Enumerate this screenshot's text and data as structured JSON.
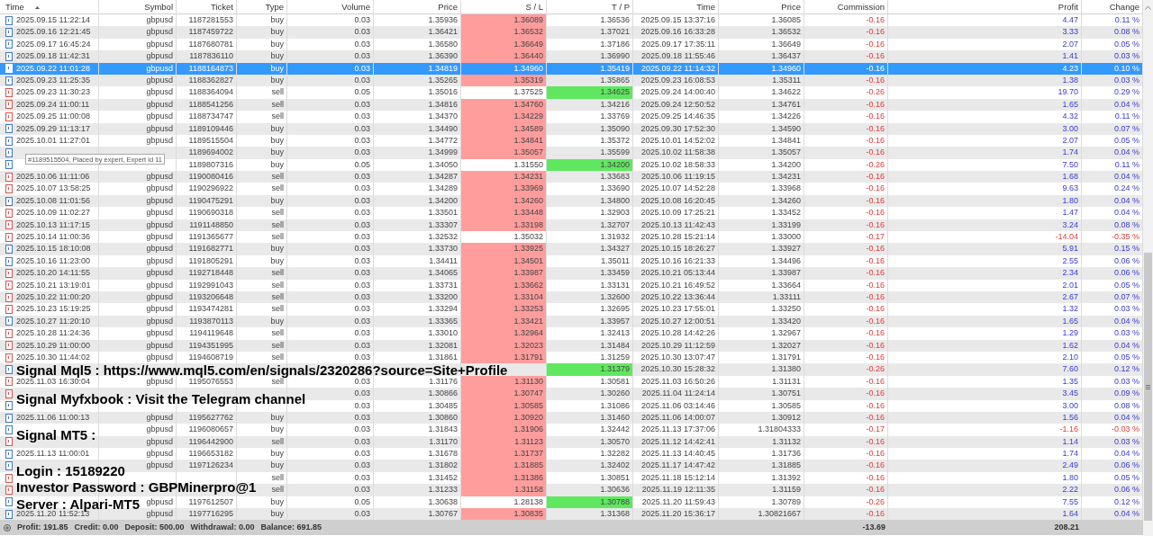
{
  "columns": [
    {
      "label": "Time",
      "sorted": true
    },
    {
      "label": "Symbol",
      "sorted": false
    },
    {
      "label": "Ticket",
      "sorted": false
    },
    {
      "label": "Type",
      "sorted": false
    },
    {
      "label": "Volume",
      "sorted": false
    },
    {
      "label": "Price",
      "sorted": false
    },
    {
      "label": "S / L",
      "sorted": false
    },
    {
      "label": "T / P",
      "sorted": false
    },
    {
      "label": "Time",
      "sorted": false
    },
    {
      "label": "Price",
      "sorted": false
    },
    {
      "label": "Commission",
      "sorted": false
    },
    {
      "label": "Profit",
      "sorted": false
    },
    {
      "label": "Change",
      "sorted": false
    }
  ],
  "rows": [
    {
      "kind": "buy",
      "selected": false,
      "sl_hit": true,
      "tp_hit": false,
      "loss": false,
      "time": "2025.09.15 11:22:14",
      "symbol": "gbpusd",
      "ticket": "1187281553",
      "type": "buy",
      "volume": "0.03",
      "price": "1.35936",
      "sl": "1.36089",
      "tp": "1.36536",
      "close_time": "2025.09.15 13:37:16",
      "close_price": "1.36085",
      "commission": "-0.16",
      "profit": "4.47",
      "change": "0.11 %"
    },
    {
      "kind": "buy",
      "selected": false,
      "sl_hit": true,
      "tp_hit": false,
      "loss": false,
      "time": "2025.09.16 12:21:45",
      "symbol": "gbpusd",
      "ticket": "1187459722",
      "type": "buy",
      "volume": "0.03",
      "price": "1.36421",
      "sl": "1.36532",
      "tp": "1.37021",
      "close_time": "2025.09.16 16:33:28",
      "close_price": "1.36532",
      "commission": "-0.16",
      "profit": "3.33",
      "change": "0.08 %"
    },
    {
      "kind": "buy",
      "selected": false,
      "sl_hit": true,
      "tp_hit": false,
      "loss": false,
      "time": "2025.09.17 16:45:24",
      "symbol": "gbpusd",
      "ticket": "1187680781",
      "type": "buy",
      "volume": "0.03",
      "price": "1.36580",
      "sl": "1.36649",
      "tp": "1.37186",
      "close_time": "2025.09.17 17:35:11",
      "close_price": "1.36649",
      "commission": "-0.16",
      "profit": "2.07",
      "change": "0.05 %"
    },
    {
      "kind": "buy",
      "selected": false,
      "sl_hit": true,
      "tp_hit": false,
      "loss": false,
      "time": "2025.09.18 11:42:31",
      "symbol": "gbpusd",
      "ticket": "1187836110",
      "type": "buy",
      "volume": "0.03",
      "price": "1.36390",
      "sl": "1.36440",
      "tp": "1.36990",
      "close_time": "2025.09.18 11:55:46",
      "close_price": "1.36437",
      "commission": "-0.16",
      "profit": "1.41",
      "change": "0.03 %"
    },
    {
      "kind": "buy",
      "selected": true,
      "sl_hit": false,
      "tp_hit": false,
      "loss": false,
      "time": "2025.09.22 11:01:28",
      "symbol": "gbpusd",
      "ticket": "1188164873",
      "type": "buy",
      "volume": "0.03",
      "price": "1.34819",
      "sl": "1.34960",
      "tp": "1.35419",
      "close_time": "2025.09.22 11:14:32",
      "close_price": "1.34960",
      "commission": "-0.16",
      "profit": "4.23",
      "change": "0.10 %"
    },
    {
      "kind": "buy",
      "selected": false,
      "sl_hit": true,
      "tp_hit": false,
      "loss": false,
      "time": "2025.09.23 11:25:35",
      "symbol": "gbpusd",
      "ticket": "1188362827",
      "type": "buy",
      "volume": "0.03",
      "price": "1.35265",
      "sl": "1.35319",
      "tp": "1.35865",
      "close_time": "2025.09.23 16:08:53",
      "close_price": "1.35311",
      "commission": "-0.16",
      "profit": "1.38",
      "change": "0.03 %"
    },
    {
      "kind": "sell",
      "selected": false,
      "sl_hit": false,
      "tp_hit": true,
      "loss": false,
      "time": "2025.09.23 11:30:23",
      "symbol": "gbpusd",
      "ticket": "1188364094",
      "type": "sell",
      "volume": "0.05",
      "price": "1.35016",
      "sl": "1.37525",
      "tp": "1.34625",
      "close_time": "2025.09.24 14:00:40",
      "close_price": "1.34622",
      "commission": "-0.26",
      "profit": "19.70",
      "change": "0.29 %"
    },
    {
      "kind": "sell",
      "selected": false,
      "sl_hit": true,
      "tp_hit": false,
      "loss": false,
      "time": "2025.09.24 11:00:11",
      "symbol": "gbpusd",
      "ticket": "1188541256",
      "type": "sell",
      "volume": "0.03",
      "price": "1.34816",
      "sl": "1.34760",
      "tp": "1.34216",
      "close_time": "2025.09.24 12:50:52",
      "close_price": "1.34761",
      "commission": "-0.16",
      "profit": "1.65",
      "change": "0.04 %"
    },
    {
      "kind": "sell",
      "selected": false,
      "sl_hit": true,
      "tp_hit": false,
      "loss": false,
      "time": "2025.09.25 11:00:08",
      "symbol": "gbpusd",
      "ticket": "1188734747",
      "type": "sell",
      "volume": "0.03",
      "price": "1.34370",
      "sl": "1.34229",
      "tp": "1.33769",
      "close_time": "2025.09.25 14:46:35",
      "close_price": "1.34226",
      "commission": "-0.16",
      "profit": "4.32",
      "change": "0.11 %"
    },
    {
      "kind": "buy",
      "selected": false,
      "sl_hit": true,
      "tp_hit": false,
      "loss": false,
      "time": "2025.09.29 11:13:17",
      "symbol": "gbpusd",
      "ticket": "1189109446",
      "type": "buy",
      "volume": "0.03",
      "price": "1.34490",
      "sl": "1.34589",
      "tp": "1.35090",
      "close_time": "2025.09.30 17:52:30",
      "close_price": "1.34590",
      "commission": "-0.16",
      "profit": "3.00",
      "change": "0.07 %"
    },
    {
      "kind": "buy",
      "selected": false,
      "sl_hit": true,
      "tp_hit": false,
      "loss": false,
      "time": "2025.10.01 11:27:01",
      "symbol": "gbpusd",
      "ticket": "1189515504",
      "type": "buy",
      "volume": "0.03",
      "price": "1.34772",
      "sl": "1.34841",
      "tp": "1.35372",
      "close_time": "2025.10.01 14:52:02",
      "close_price": "1.34841",
      "commission": "-0.16",
      "profit": "2.07",
      "change": "0.05 %"
    },
    {
      "kind": "buy",
      "selected": false,
      "sl_hit": true,
      "tp_hit": false,
      "loss": false,
      "ticket": "1189694002",
      "type": "buy",
      "volume": "0.03",
      "price": "1.34999",
      "sl": "1.35057",
      "tp": "1.35599",
      "close_time": "2025.10.02 11:58:38",
      "close_price": "1.35057",
      "commission": "-0.16",
      "profit": "1.74",
      "change": "0.04 %"
    },
    {
      "kind": "buy",
      "selected": false,
      "sl_hit": false,
      "tp_hit": true,
      "loss": false,
      "ticket": "1189807316",
      "type": "buy",
      "volume": "0.05",
      "price": "1.34050",
      "sl": "1.31550",
      "tp": "1.34200",
      "close_time": "2025.10.02 18:58:33",
      "close_price": "1.34200",
      "commission": "-0.26",
      "profit": "7.50",
      "change": "0.11 %"
    },
    {
      "kind": "sell",
      "selected": false,
      "sl_hit": true,
      "tp_hit": false,
      "loss": false,
      "time": "2025.10.06 11:11:06",
      "symbol": "gbpusd",
      "ticket": "1190080416",
      "type": "sell",
      "volume": "0.03",
      "price": "1.34287",
      "sl": "1.34231",
      "tp": "1.33683",
      "close_time": "2025.10.06 11:19:15",
      "close_price": "1.34231",
      "commission": "-0.16",
      "profit": "1.68",
      "change": "0.04 %"
    },
    {
      "kind": "sell",
      "selected": false,
      "sl_hit": true,
      "tp_hit": false,
      "loss": false,
      "time": "2025.10.07 13:58:25",
      "symbol": "gbpusd",
      "ticket": "1190296922",
      "type": "sell",
      "volume": "0.03",
      "price": "1.34289",
      "sl": "1.33969",
      "tp": "1.33690",
      "close_time": "2025.10.07 14:52:28",
      "close_price": "1.33968",
      "commission": "-0.16",
      "profit": "9.63",
      "change": "0.24 %"
    },
    {
      "kind": "buy",
      "selected": false,
      "sl_hit": true,
      "tp_hit": false,
      "loss": false,
      "time": "2025.10.08 11:01:56",
      "symbol": "gbpusd",
      "ticket": "1190475291",
      "type": "buy",
      "volume": "0.03",
      "price": "1.34200",
      "sl": "1.34260",
      "tp": "1.34800",
      "close_time": "2025.10.08 16:20:45",
      "close_price": "1.34260",
      "commission": "-0.16",
      "profit": "1.80",
      "change": "0.04 %"
    },
    {
      "kind": "sell",
      "selected": false,
      "sl_hit": true,
      "tp_hit": false,
      "loss": false,
      "time": "2025.10.09 11:02:27",
      "symbol": "gbpusd",
      "ticket": "1190690318",
      "type": "sell",
      "volume": "0.03",
      "price": "1.33501",
      "sl": "1.33448",
      "tp": "1.32903",
      "close_time": "2025.10.09 17:25:21",
      "close_price": "1.33452",
      "commission": "-0.16",
      "profit": "1.47",
      "change": "0.04 %"
    },
    {
      "kind": "sell",
      "selected": false,
      "sl_hit": true,
      "tp_hit": false,
      "loss": false,
      "time": "2025.10.13 11:17:15",
      "symbol": "gbpusd",
      "ticket": "1191148850",
      "type": "sell",
      "volume": "0.03",
      "price": "1.33307",
      "sl": "1.33198",
      "tp": "1.32707",
      "close_time": "2025.10.13 11:42:43",
      "close_price": "1.33199",
      "commission": "-0.16",
      "profit": "3.24",
      "change": "0.08 %"
    },
    {
      "kind": "sell",
      "selected": false,
      "sl_hit": false,
      "tp_hit": false,
      "loss": true,
      "time": "2025.10.14 11:00:36",
      "symbol": "gbpusd",
      "ticket": "1191365677",
      "type": "sell",
      "volume": "0.03",
      "price": "1.32532",
      "sl": "1.35032",
      "tp": "1.31932",
      "close_time": "2025.10.28 15:21:14",
      "close_price": "1.33000",
      "commission": "-0.17",
      "profit": "-14.04",
      "change": "-0.35 %"
    },
    {
      "kind": "buy",
      "selected": false,
      "sl_hit": true,
      "tp_hit": false,
      "loss": false,
      "time": "2025.10.15 18:10:08",
      "symbol": "gbpusd",
      "ticket": "1191682771",
      "type": "buy",
      "volume": "0.03",
      "price": "1.33730",
      "sl": "1.33925",
      "tp": "1.34327",
      "close_time": "2025.10.15 18:26:27",
      "close_price": "1.33927",
      "commission": "-0.16",
      "profit": "5.91",
      "change": "0.15 %"
    },
    {
      "kind": "buy",
      "selected": false,
      "sl_hit": true,
      "tp_hit": false,
      "loss": false,
      "time": "2025.10.16 11:23:00",
      "symbol": "gbpusd",
      "ticket": "1191805291",
      "type": "buy",
      "volume": "0.03",
      "price": "1.34411",
      "sl": "1.34501",
      "tp": "1.35011",
      "close_time": "2025.10.16 16:21:33",
      "close_price": "1.34496",
      "commission": "-0.16",
      "profit": "2.55",
      "change": "0.06 %"
    },
    {
      "kind": "sell",
      "selected": false,
      "sl_hit": true,
      "tp_hit": false,
      "loss": false,
      "time": "2025.10.20 14:11:55",
      "symbol": "gbpusd",
      "ticket": "1192718448",
      "type": "sell",
      "volume": "0.03",
      "price": "1.34065",
      "sl": "1.33987",
      "tp": "1.33459",
      "close_time": "2025.10.21 05:13:44",
      "close_price": "1.33987",
      "commission": "-0.16",
      "profit": "2.34",
      "change": "0.06 %"
    },
    {
      "kind": "sell",
      "selected": false,
      "sl_hit": true,
      "tp_hit": false,
      "loss": false,
      "time": "2025.10.21 13:19:01",
      "symbol": "gbpusd",
      "ticket": "1192991043",
      "type": "sell",
      "volume": "0.03",
      "price": "1.33731",
      "sl": "1.33662",
      "tp": "1.33131",
      "close_time": "2025.10.21 16:49:52",
      "close_price": "1.33664",
      "commission": "-0.16",
      "profit": "2.01",
      "change": "0.05 %"
    },
    {
      "kind": "sell",
      "selected": false,
      "sl_hit": true,
      "tp_hit": false,
      "loss": false,
      "time": "2025.10.22 11:00:20",
      "symbol": "gbpusd",
      "ticket": "1193206648",
      "type": "sell",
      "volume": "0.03",
      "price": "1.33200",
      "sl": "1.33104",
      "tp": "1.32600",
      "close_time": "2025.10.22 13:36:44",
      "close_price": "1.33111",
      "commission": "-0.16",
      "profit": "2.67",
      "change": "0.07 %"
    },
    {
      "kind": "sell",
      "selected": false,
      "sl_hit": true,
      "tp_hit": false,
      "loss": false,
      "time": "2025.10.23 15:19:25",
      "symbol": "gbpusd",
      "ticket": "1193474281",
      "type": "sell",
      "volume": "0.03",
      "price": "1.33294",
      "sl": "1.33253",
      "tp": "1.32695",
      "close_time": "2025.10.23 17:55:01",
      "close_price": "1.33250",
      "commission": "-0.16",
      "profit": "1.32",
      "change": "0.03 %"
    },
    {
      "kind": "buy",
      "selected": false,
      "sl_hit": true,
      "tp_hit": false,
      "loss": false,
      "time": "2025.10.27 11:20:10",
      "symbol": "gbpusd",
      "ticket": "1193870113",
      "type": "buy",
      "volume": "0.03",
      "price": "1.33365",
      "sl": "1.33421",
      "tp": "1.33957",
      "close_time": "2025.10.27 12:00:51",
      "close_price": "1.33420",
      "commission": "-0.16",
      "profit": "1.65",
      "change": "0.04 %"
    },
    {
      "kind": "sell",
      "selected": false,
      "sl_hit": true,
      "tp_hit": false,
      "loss": false,
      "time": "2025.10.28 11:24:36",
      "symbol": "gbpusd",
      "ticket": "1194119648",
      "type": "sell",
      "volume": "0.03",
      "price": "1.33010",
      "sl": "1.32964",
      "tp": "1.32413",
      "close_time": "2025.10.28 14:42:26",
      "close_price": "1.32967",
      "commission": "-0.16",
      "profit": "1.29",
      "change": "0.03 %"
    },
    {
      "kind": "sell",
      "selected": false,
      "sl_hit": true,
      "tp_hit": false,
      "loss": false,
      "time": "2025.10.29 11:00:00",
      "symbol": "gbpusd",
      "ticket": "1194351995",
      "type": "sell",
      "volume": "0.03",
      "price": "1.32081",
      "sl": "1.32023",
      "tp": "1.31484",
      "close_time": "2025.10.29 11:12:59",
      "close_price": "1.32027",
      "commission": "-0.16",
      "profit": "1.62",
      "change": "0.04 %"
    },
    {
      "kind": "sell",
      "selected": false,
      "sl_hit": true,
      "tp_hit": false,
      "loss": false,
      "time": "2025.10.30 11:44:02",
      "symbol": "gbpusd",
      "ticket": "1194608719",
      "type": "sell",
      "volume": "0.03",
      "price": "1.31861",
      "sl": "1.31791",
      "tp": "1.31259",
      "close_time": "2025.10.30 13:07:47",
      "close_price": "1.31791",
      "commission": "-0.16",
      "profit": "2.10",
      "change": "0.05 %"
    },
    {
      "kind": "buy",
      "selected": false,
      "tp_hit": true,
      "loss": false,
      "tp": "1.31379",
      "close_time": "2025.10.30 15:28:32",
      "close_price": "1.31380",
      "commission": "-0.26",
      "profit": "7.60",
      "change": "0.12 %"
    },
    {
      "kind": "sell",
      "selected": false,
      "sl_hit": true,
      "tp_hit": false,
      "loss": false,
      "time": "2025.11.03 16:30:04",
      "symbol": "gbpusd",
      "ticket": "1195076553",
      "type": "sell",
      "volume": "0.03",
      "price": "1.31176",
      "sl": "1.31130",
      "tp": "1.30581",
      "close_time": "2025.11.03 16:50:26",
      "close_price": "1.31131",
      "commission": "-0.16",
      "profit": "1.35",
      "change": "0.03 %"
    },
    {
      "kind": "sell",
      "selected": false,
      "sl_hit": true,
      "tp_hit": false,
      "loss": false,
      "volume": "0.03",
      "price": "1.30866",
      "sl": "1.30747",
      "tp": "1.30260",
      "close_time": "2025.11.04 11:24:14",
      "close_price": "1.30751",
      "commission": "-0.16",
      "profit": "3.45",
      "change": "0.09 %"
    },
    {
      "kind": "buy",
      "selected": false,
      "sl_hit": true,
      "tp_hit": false,
      "loss": false,
      "volume": "0.03",
      "price": "1.30485",
      "sl": "1.30585",
      "tp": "1.31086",
      "close_time": "2025.11.06 03:14:46",
      "close_price": "1.30585",
      "commission": "-0.16",
      "profit": "3.00",
      "change": "0.08 %"
    },
    {
      "kind": "buy",
      "selected": false,
      "sl_hit": true,
      "tp_hit": false,
      "loss": false,
      "time": "2025.11.06 11:00:13",
      "symbol": "gbpusd",
      "ticket": "1195627762",
      "type": "buy",
      "volume": "0.03",
      "price": "1.30860",
      "sl": "1.30920",
      "tp": "1.31460",
      "close_time": "2025.11.06 14:00:07",
      "close_price": "1.30912",
      "commission": "-0.16",
      "profit": "1.56",
      "change": "0.04 %"
    },
    {
      "kind": "buy",
      "selected": false,
      "sl_hit": true,
      "tp_hit": false,
      "loss": true,
      "symbol": "gbpusd",
      "ticket": "1196080657",
      "type": "buy",
      "volume": "0.03",
      "price": "1.31843",
      "sl": "1.31906",
      "tp": "1.32442",
      "close_time": "2025.11.13 17:37:06",
      "close_price": "1.31804333",
      "commission": "-0.17",
      "profit": "-1.16",
      "change": "-0.03 %"
    },
    {
      "kind": "sell",
      "selected": false,
      "sl_hit": true,
      "tp_hit": false,
      "loss": false,
      "symbol": "gbpusd",
      "ticket": "1196442900",
      "type": "sell",
      "volume": "0.03",
      "price": "1.31170",
      "sl": "1.31123",
      "tp": "1.30570",
      "close_time": "2025.11.12 14:42:41",
      "close_price": "1.31132",
      "commission": "-0.16",
      "profit": "1.14",
      "change": "0.03 %"
    },
    {
      "kind": "buy",
      "selected": false,
      "sl_hit": true,
      "tp_hit": false,
      "loss": false,
      "time": "2025.11.13 11:00:01",
      "symbol": "gbpusd",
      "ticket": "1196653182",
      "type": "buy",
      "volume": "0.03",
      "price": "1.31678",
      "sl": "1.31737",
      "tp": "1.32282",
      "close_time": "2025.11.13 14:40:45",
      "close_price": "1.31736",
      "commission": "-0.16",
      "profit": "1.74",
      "change": "0.04 %"
    },
    {
      "kind": "buy",
      "selected": false,
      "sl_hit": true,
      "tp_hit": false,
      "loss": false,
      "symbol": "gbpusd",
      "ticket": "1197126234",
      "type": "buy",
      "volume": "0.03",
      "price": "1.31802",
      "sl": "1.31885",
      "tp": "1.32402",
      "close_time": "2025.11.17 14:47:42",
      "close_price": "1.31885",
      "commission": "-0.16",
      "profit": "2.49",
      "change": "0.06 %"
    },
    {
      "kind": "sell",
      "selected": false,
      "sl_hit": true,
      "tp_hit": false,
      "loss": false,
      "type": "sell",
      "volume": "0.03",
      "price": "1.31452",
      "sl": "1.31386",
      "tp": "1.30851",
      "close_time": "2025.11.18 15:12:14",
      "close_price": "1.31392",
      "commission": "-0.16",
      "profit": "1.80",
      "change": "0.05 %"
    },
    {
      "kind": "sell",
      "selected": false,
      "sl_hit": true,
      "tp_hit": false,
      "loss": false,
      "type": "sell",
      "volume": "0.03",
      "price": "1.31233",
      "sl": "1.31158",
      "tp": "1.30636",
      "close_time": "2025.11.19 12:11:35",
      "close_price": "1.31159",
      "commission": "-0.16",
      "profit": "2.22",
      "change": "0.06 %"
    },
    {
      "kind": "buy",
      "selected": false,
      "sl_hit": false,
      "tp_hit": true,
      "loss": false,
      "symbol": "gbpusd",
      "ticket": "1197612507",
      "type": "buy",
      "volume": "0.05",
      "price": "1.30638",
      "sl": "1.28138",
      "tp": "1.30788",
      "close_time": "2025.11.20 11:59:43",
      "close_price": "1.30789",
      "commission": "-0.26",
      "profit": "7.55",
      "change": "0.12 %"
    },
    {
      "kind": "buy",
      "selected": false,
      "sl_hit": true,
      "tp_hit": false,
      "loss": false,
      "time": "2025.11.20 11:52:13",
      "symbol": "gbpusd",
      "ticket": "1197716295",
      "type": "buy",
      "volume": "0.03",
      "price": "1.30767",
      "sl": "1.30835",
      "tp": "1.31368",
      "close_time": "2025.11.20 15:36:17",
      "close_price": "1.30821667",
      "commission": "-0.16",
      "profit": "1.64",
      "change": "0.04 %"
    }
  ],
  "summary": {
    "items": [
      "Profit: 191.85",
      "Credit: 0.00",
      "Deposit: 500.00",
      "Withdrawal: 0.00",
      "Balance: 691.85"
    ],
    "commission_total": "-13.69",
    "profit_total": "208.21"
  },
  "tooltip": "#1189515504, Placed by expert, Expert id 11",
  "overlay_text": [
    "Signal Mql5 : https://www.mql5.com/en/signals/2320286?source=Site+Profile",
    "Signal Myfxbook : Visit the Telegram channel",
    "Signal MT5 :",
    "Login : 15189220",
    "Investor Password : GBPMinerpro@1",
    "Server : Alpari-MT5"
  ]
}
